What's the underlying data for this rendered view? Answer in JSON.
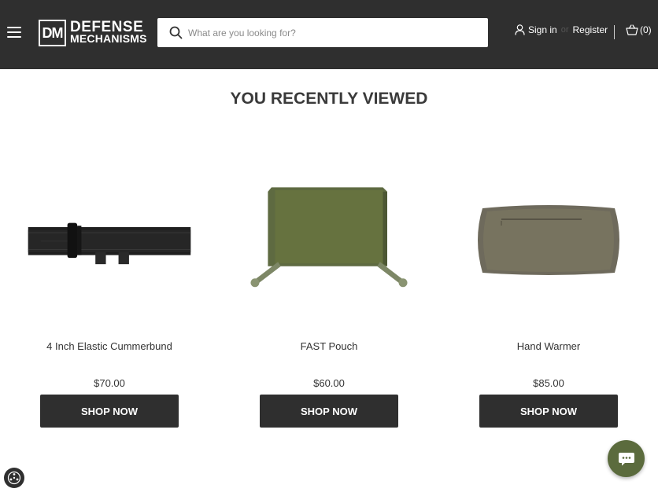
{
  "header": {
    "logo": {
      "mark": "DM",
      "line1": "DEFENSE",
      "line2": "MECHANISMS"
    },
    "search": {
      "placeholder": "What are you looking for?"
    },
    "account": {
      "sign_in": "Sign in",
      "or": "or",
      "register": "Register"
    },
    "cart": {
      "count_label": "(0)"
    }
  },
  "main": {
    "title": "YOU RECENTLY VIEWED",
    "products": [
      {
        "name": "4 Inch Elastic Cummerbund",
        "price": "$70.00",
        "button": "SHOP NOW"
      },
      {
        "name": "FAST Pouch",
        "price": "$60.00",
        "button": "SHOP NOW"
      },
      {
        "name": "Hand Warmer",
        "price": "$85.00",
        "button": "SHOP NOW"
      }
    ]
  },
  "icons": {
    "menu": "hamburger-icon",
    "search": "search-icon",
    "user": "user-icon",
    "cart": "basket-icon",
    "chat": "chat-icon",
    "accessibility": "accessibility-icon"
  },
  "colors": {
    "header_bg": "#2f2f2f",
    "button_bg": "#2f2f2f",
    "chat_bg": "#5b6b3d"
  }
}
